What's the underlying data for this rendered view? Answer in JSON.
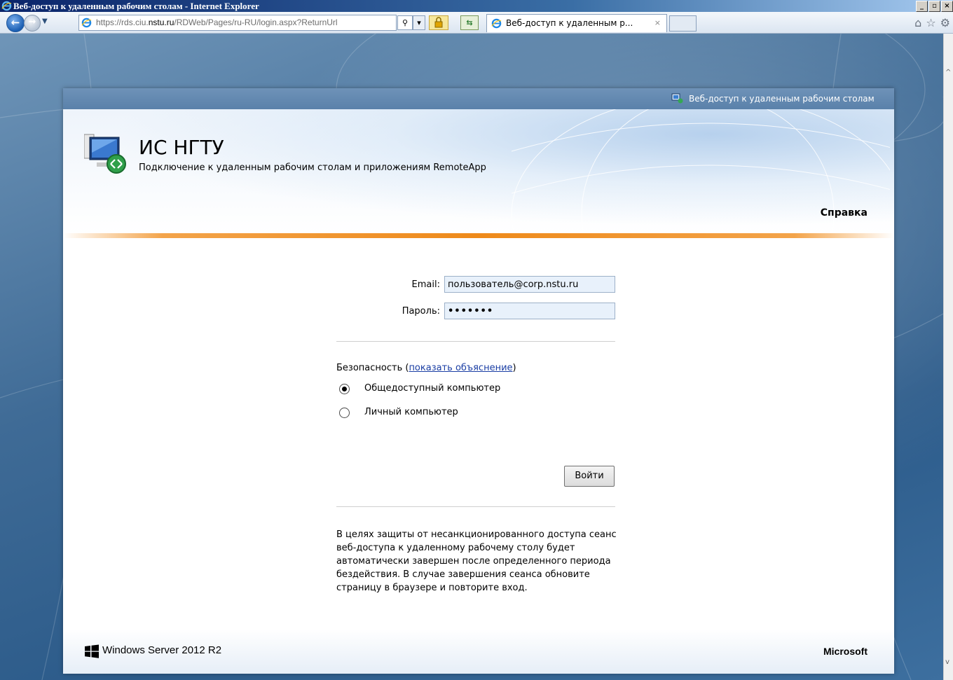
{
  "window": {
    "title": "Веб-доступ к удаленным рабочим столам - Internet Explorer",
    "min_glyph": "_",
    "max_glyph": "▫",
    "close_glyph": "×"
  },
  "browser": {
    "url_prefix": "https://rds.ciu.",
    "url_domain": "nstu.ru",
    "url_path": "/RDWeb/Pages/ru-RU/login.aspx?ReturnUrl",
    "tab_title": "Веб-доступ к удаленным р...",
    "tab_close": "×",
    "icons": [
      "back-arrow-icon",
      "forward-arrow-icon",
      "search-icon",
      "lock-icon",
      "refresh-icon",
      "home-icon",
      "star-icon",
      "gear-icon"
    ]
  },
  "header": {
    "top_link": "Веб-доступ к удаленным рабочим столам",
    "site_title": "ИС НГТУ",
    "site_subtitle": "Подключение к удаленным рабочим столам и приложениям RemoteApp",
    "help": "Справка"
  },
  "form": {
    "email_label": "Email:",
    "email_value": "пользователь@corp.nstu.ru",
    "password_label": "Пароль:",
    "password_value": "•••••••",
    "security_prefix": "Безопасность (",
    "security_link": "показать объяснение",
    "security_suffix": ")",
    "options": [
      {
        "label": "Общедоступный компьютер",
        "selected": true
      },
      {
        "label": "Личный компьютер",
        "selected": false
      }
    ],
    "submit": "Войти",
    "notice": "В целях защиты от несанкционированного доступа сеанс веб-доступа к удаленному рабочему столу будет автоматически завершен после определенного периода бездействия. В случае завершения сеанса обновите страницу в браузере и повторите вход."
  },
  "footer": {
    "product": "Windows Server 2012 R2",
    "vendor": "Microsoft"
  },
  "colors": {
    "accent_orange": "#ee8a1a",
    "header_blue": "#5a81aa",
    "link_blue": "#1a3ea4"
  }
}
